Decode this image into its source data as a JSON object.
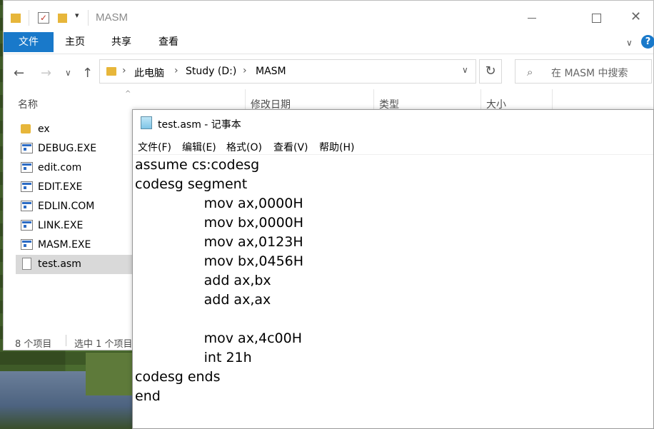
{
  "explorer": {
    "title": "MASM",
    "ribbon_tabs": {
      "file": "文件",
      "home": "主页",
      "share": "共享",
      "view": "查看"
    },
    "address_parts": [
      "此电脑",
      "Study (D:)",
      "MASM"
    ],
    "search_placeholder": "在 MASM 中搜索",
    "columns": {
      "name": "名称",
      "modified": "修改日期",
      "type": "类型",
      "size": "大小"
    },
    "files": [
      {
        "name": "ex",
        "icon": "folder-icon"
      },
      {
        "name": "DEBUG.EXE",
        "icon": "exe-icon"
      },
      {
        "name": "edit.com",
        "icon": "exe-icon"
      },
      {
        "name": "EDIT.EXE",
        "icon": "exe-icon"
      },
      {
        "name": "EDLIN.COM",
        "icon": "exe-icon"
      },
      {
        "name": "LINK.EXE",
        "icon": "exe-icon"
      },
      {
        "name": "MASM.EXE",
        "icon": "exe-icon"
      },
      {
        "name": "test.asm",
        "icon": "text-file-icon",
        "selected": true
      }
    ],
    "status": {
      "count": "8 个项目",
      "selected": "选中 1 个项目"
    }
  },
  "notepad": {
    "title": "test.asm - 记事本",
    "menu": {
      "file": "文件(F)",
      "edit": "编辑(E)",
      "format": "格式(O)",
      "view": "查看(V)",
      "help": "帮助(H)"
    },
    "content": "assume cs:codesg\ncodesg segment\n                mov ax,0000H\n                mov bx,0000H\n                mov ax,0123H\n                mov bx,0456H\n                add ax,bx\n                add ax,ax\n\n                mov ax,4c00H\n                int 21h\ncodesg ends\nend"
  },
  "colors": {
    "accent": "#1979ca",
    "selection": "#d9d9d9",
    "folder": "#e7b63a"
  }
}
